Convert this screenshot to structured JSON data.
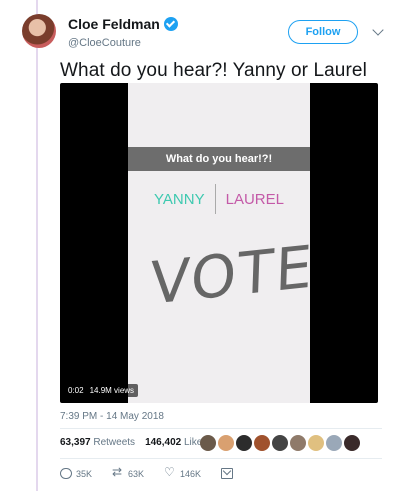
{
  "author": {
    "name": "Cloe Feldman",
    "handle": "@CloeCouture",
    "verified": true,
    "follow_label": "Follow"
  },
  "tweet": {
    "text": "What do you hear?! Yanny or Laurel",
    "timestamp": "7:39 PM - 14 May 2018"
  },
  "video": {
    "question": "What do you hear!?!",
    "option_a": "YANNY",
    "option_b": "LAUREL",
    "vote_text": "VOTE",
    "duration": "0:02",
    "views": "14.9M views"
  },
  "stats": {
    "retweets_count": "63,397",
    "retweets_label": "Retweets",
    "likes_count": "146,402",
    "likes_label": "Likes",
    "liker_colors": [
      "#6b5a4a",
      "#d9a070",
      "#2c2c2c",
      "#a0522d",
      "#444444",
      "#8f7a6a",
      "#e0c080",
      "#9aa8b8",
      "#3a2a2a"
    ]
  },
  "actions": {
    "reply_count": "35K",
    "retweet_count": "63K",
    "like_count": "146K"
  },
  "colors": {
    "accent": "#1da1f2",
    "yanny": "#3ec9b0",
    "laurel": "#c45aa8"
  }
}
